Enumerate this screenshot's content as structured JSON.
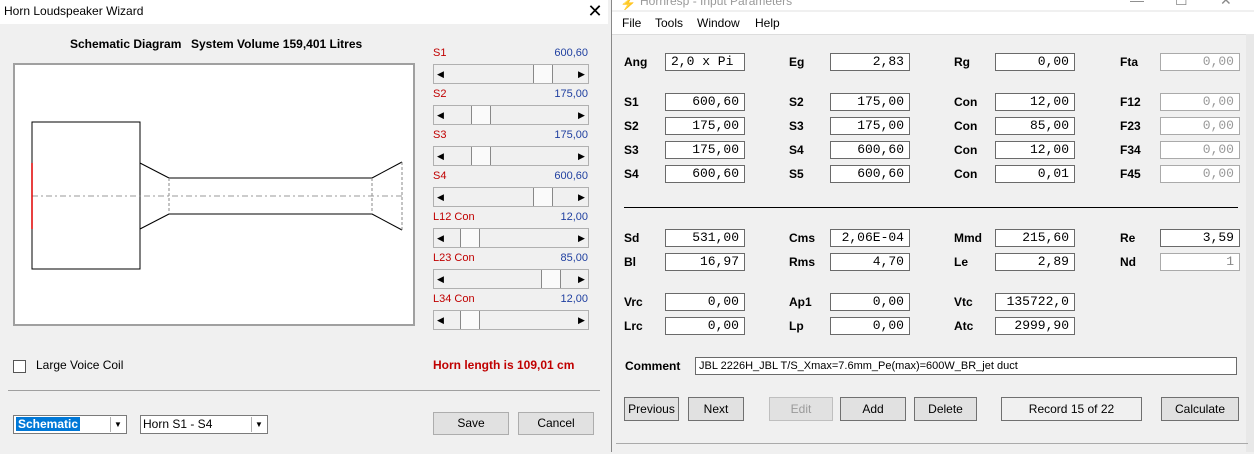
{
  "wizard": {
    "title": "Horn Loudspeaker Wizard",
    "close_glyph": "✕",
    "schematic_label": "Schematic Diagram",
    "system_volume": "System Volume 159,401 Litres",
    "sliders": [
      {
        "label": "S1",
        "value": "600,60",
        "thumb": 0.78
      },
      {
        "label": "S2",
        "value": "175,00",
        "thumb": 0.22
      },
      {
        "label": "S3",
        "value": "175,00",
        "thumb": 0.22
      },
      {
        "label": "S4",
        "value": "600,60",
        "thumb": 0.78
      },
      {
        "label": "L12  Con",
        "value": "12,00",
        "thumb": 0.12
      },
      {
        "label": "L23  Con",
        "value": "85,00",
        "thumb": 0.85
      },
      {
        "label": "L34  Con",
        "value": "12,00",
        "thumb": 0.12
      }
    ],
    "large_voice_coil_label": "Large Voice Coil",
    "horn_length": "Horn length is 109,01 cm",
    "view_select": "Schematic",
    "horn_select": "Horn S1 - S4",
    "save_label": "Save",
    "cancel_label": "Cancel"
  },
  "hornresp": {
    "title": "Hornresp - Input Parameters",
    "menu": [
      "File",
      "Tools",
      "Window",
      "Help"
    ],
    "row_ang": [
      {
        "label": "Ang",
        "value": "2,0 x Pi"
      },
      {
        "label": "Eg",
        "value": "2,83"
      },
      {
        "label": "Rg",
        "value": "0,00"
      },
      {
        "label": "Fta",
        "value": "0,00"
      }
    ],
    "horn_rows": [
      [
        {
          "label": "S1",
          "value": "600,60"
        },
        {
          "label": "S2",
          "value": "175,00"
        },
        {
          "label": "Con",
          "value": "12,00"
        },
        {
          "label": "F12",
          "value": "0,00"
        }
      ],
      [
        {
          "label": "S2",
          "value": "175,00"
        },
        {
          "label": "S3",
          "value": "175,00"
        },
        {
          "label": "Con",
          "value": "85,00"
        },
        {
          "label": "F23",
          "value": "0,00"
        }
      ],
      [
        {
          "label": "S3",
          "value": "175,00"
        },
        {
          "label": "S4",
          "value": "600,60"
        },
        {
          "label": "Con",
          "value": "12,00"
        },
        {
          "label": "F34",
          "value": "0,00"
        }
      ],
      [
        {
          "label": "S4",
          "value": "600,60"
        },
        {
          "label": "S5",
          "value": "600,60"
        },
        {
          "label": "Con",
          "value": "0,01"
        },
        {
          "label": "F45",
          "value": "0,00"
        }
      ]
    ],
    "driver_rows": [
      [
        {
          "label": "Sd",
          "value": "531,00"
        },
        {
          "label": "Cms",
          "value": "2,06E-04"
        },
        {
          "label": "Mmd",
          "value": "215,60"
        },
        {
          "label": "Re",
          "value": "3,59"
        }
      ],
      [
        {
          "label": "Bl",
          "value": "16,97"
        },
        {
          "label": "Rms",
          "value": "4,70"
        },
        {
          "label": "Le",
          "value": "2,89"
        },
        {
          "label": "Nd",
          "value": "1"
        }
      ]
    ],
    "chamber_rows": [
      [
        {
          "label": "Vrc",
          "value": "0,00"
        },
        {
          "label": "Ap1",
          "value": "0,00"
        },
        {
          "label": "Vtc",
          "value": "135722,0"
        }
      ],
      [
        {
          "label": "Lrc",
          "value": "0,00"
        },
        {
          "label": "Lp",
          "value": "0,00"
        },
        {
          "label": "Atc",
          "value": "2999,90"
        }
      ]
    ],
    "comment_label": "Comment",
    "comment": "JBL 2226H_JBL T/S_Xmax=7.6mm_Pe(max)=600W_BR_jet duct",
    "buttons": {
      "previous": "Previous",
      "next": "Next",
      "edit": "Edit",
      "add": "Add",
      "delete": "Delete",
      "record": "Record 15 of 22",
      "calculate": "Calculate"
    }
  }
}
